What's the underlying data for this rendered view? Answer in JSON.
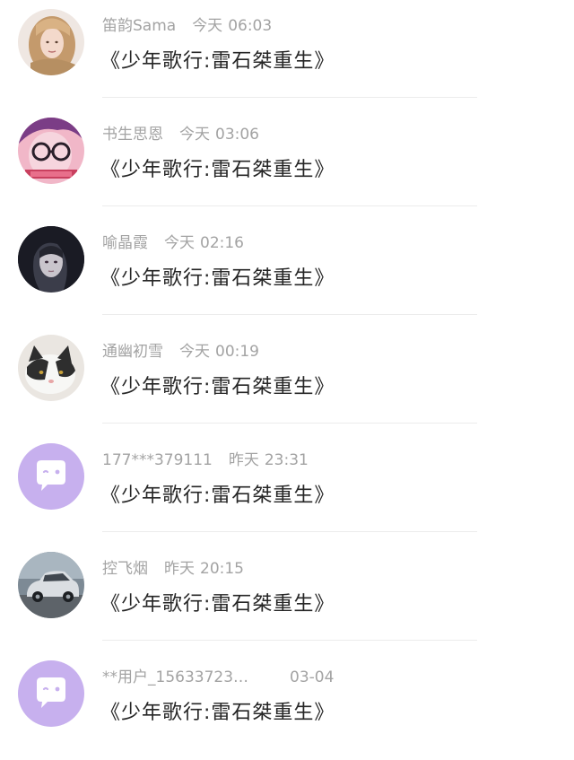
{
  "comments": [
    {
      "user": "笛韵Sama",
      "day": "今天",
      "time": "06:03",
      "text": "《少年歌行:雷石桀重生》",
      "avatar_icon": "user-photo-blonde"
    },
    {
      "user": "书生思恩",
      "day": "今天",
      "time": "03:06",
      "text": "《少年歌行:雷石桀重生》",
      "avatar_icon": "user-photo-glasses"
    },
    {
      "user": "喻晶霞",
      "day": "今天",
      "time": "02:16",
      "text": "《少年歌行:雷石桀重生》",
      "avatar_icon": "user-photo-dark-anime"
    },
    {
      "user": "通幽初雪",
      "day": "今天",
      "time": "00:19",
      "text": "《少年歌行:雷石桀重生》",
      "avatar_icon": "user-photo-cat"
    },
    {
      "user": "177***379111",
      "day": "昨天",
      "time": "23:31",
      "text": "《少年歌行:雷石桀重生》",
      "avatar_icon": "default-chat-avatar"
    },
    {
      "user": "控飞烟",
      "day": "昨天",
      "time": "20:15",
      "text": "《少年歌行:雷石桀重生》",
      "avatar_icon": "user-photo-car"
    },
    {
      "user": "**用户_15633723…",
      "day": "",
      "time": "03-04",
      "text": "《少年歌行:雷石桀重生》",
      "avatar_icon": "default-chat-avatar"
    }
  ],
  "colors": {
    "meta_text": "#a3a3a3",
    "comment_text": "#262626",
    "default_avatar": "#c7b0ee",
    "divider": "#ececec"
  }
}
